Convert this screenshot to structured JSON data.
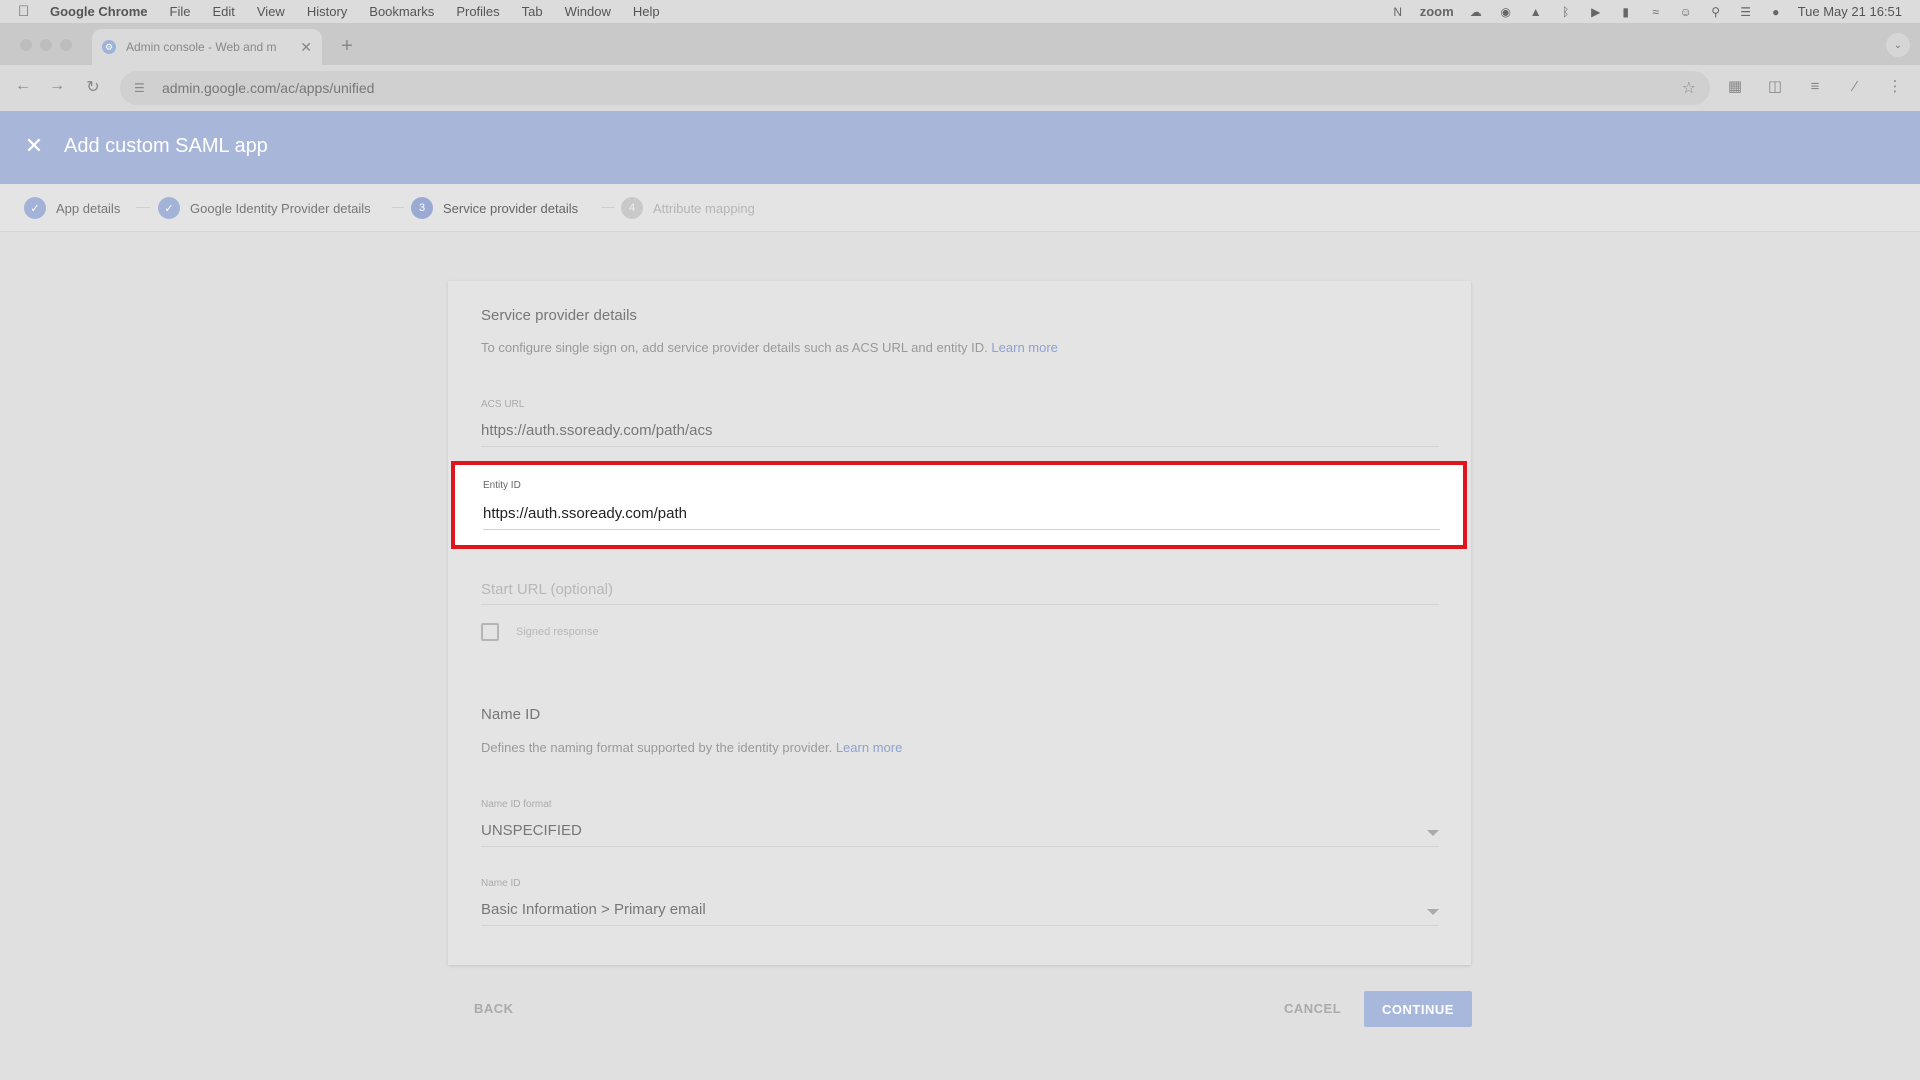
{
  "menubar": {
    "app_name": "Google Chrome",
    "items": [
      "File",
      "Edit",
      "View",
      "History",
      "Bookmarks",
      "Profiles",
      "Tab",
      "Window",
      "Help"
    ],
    "zoom_label": "zoom",
    "datetime": "Tue May 21  16:51"
  },
  "browser": {
    "tab_title": "Admin console - Web and m",
    "url": "admin.google.com/ac/apps/unified"
  },
  "header": {
    "title": "Add custom SAML app"
  },
  "stepper": {
    "steps": [
      {
        "label": "App details",
        "status": "done"
      },
      {
        "label": "Google Identity Provider details",
        "status": "done"
      },
      {
        "number": "3",
        "label": "Service provider details",
        "status": "active"
      },
      {
        "number": "4",
        "label": "Attribute mapping",
        "status": "pending"
      }
    ]
  },
  "card": {
    "heading": "Service provider details",
    "description": "To configure single sign on, add service provider details such as ACS URL and entity ID.",
    "learn_more": "Learn more",
    "acs_url_label": "ACS URL",
    "acs_url_value": "https://auth.ssoready.com/path/acs",
    "entity_id_label": "Entity ID",
    "entity_id_value": "https://auth.ssoready.com/path",
    "start_url_placeholder": "Start URL (optional)",
    "signed_response_label": "Signed response",
    "name_id_heading": "Name ID",
    "name_id_description": "Defines the naming format supported by the identity provider.",
    "name_id_learn_more": "Learn more",
    "name_id_format_label": "Name ID format",
    "name_id_format_value": "UNSPECIFIED",
    "name_id_label": "Name ID",
    "name_id_value": "Basic Information > Primary email"
  },
  "footer": {
    "back_label": "BACK",
    "cancel_label": "CANCEL",
    "continue_label": "CONTINUE"
  },
  "colors": {
    "header_bg": "#a7b6d9",
    "highlight_border": "#e0141c",
    "continue_bg": "#a8b7dc"
  }
}
